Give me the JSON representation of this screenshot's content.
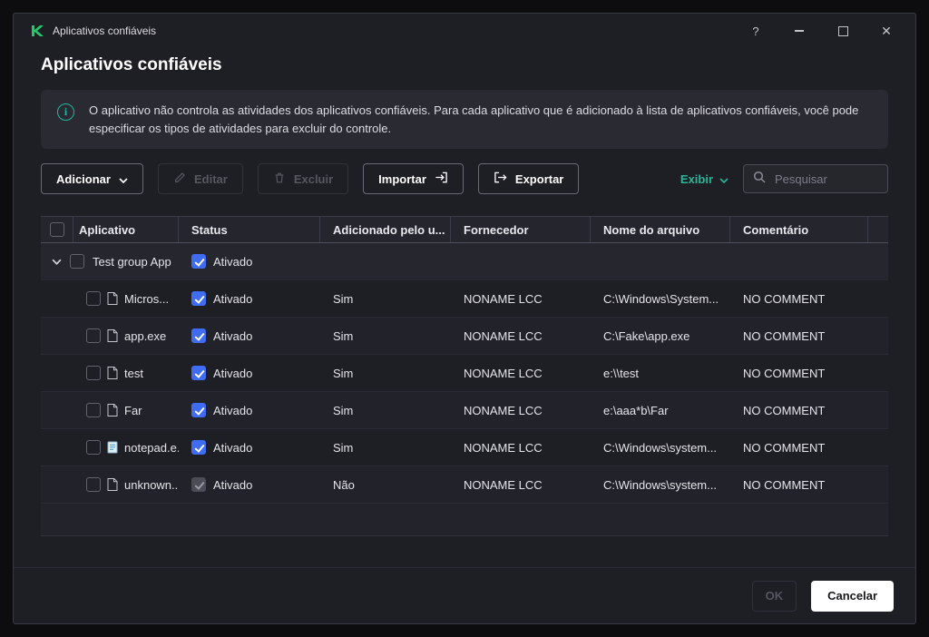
{
  "colors": {
    "accent": "#27b79a",
    "logo_green": "#23c968",
    "checkbox_checked": "#3f6cf0"
  },
  "icons": [
    "kaspersky-logo",
    "help-icon",
    "minimize-icon",
    "maximize-icon",
    "close-icon",
    "info-icon",
    "pencil-icon",
    "trash-icon",
    "import-icon",
    "export-icon",
    "chevron-down-icon",
    "search-icon",
    "file-icon",
    "notepad-icon"
  ],
  "window": {
    "title": "Aplicativos confiáveis",
    "help": "?",
    "close": "✕"
  },
  "page": {
    "title": "Aplicativos confiáveis",
    "info_text": "O aplicativo não controla as atividades dos aplicativos confiáveis. Para cada aplicativo que é adicionado à lista de aplicativos confiáveis, você pode especificar os tipos de atividades para excluir do controle."
  },
  "toolbar": {
    "add_label": "Adicionar",
    "edit_label": "Editar",
    "delete_label": "Excluir",
    "import_label": "Importar",
    "export_label": "Exportar",
    "view_label": "Exibir",
    "search_placeholder": "Pesquisar"
  },
  "table": {
    "columns": [
      "Aplicativo",
      "Status",
      "Adicionado pelo u...",
      "Fornecedor",
      "Nome do arquivo",
      "Comentário"
    ],
    "group_row": {
      "name": "Test group App",
      "status_label": "Ativado",
      "status_enabled": true
    },
    "rows": [
      {
        "name": "Micros...",
        "status_label": "Ativado",
        "status_enabled": true,
        "added_by_user": "Sim",
        "vendor": "NONAME LCC",
        "file_path": "C:\\Windows\\System...",
        "comment": "NO COMMENT"
      },
      {
        "name": "app.exe",
        "status_label": "Ativado",
        "status_enabled": true,
        "added_by_user": "Sim",
        "vendor": "NONAME LCC",
        "file_path": "C:\\Fake\\app.exe",
        "comment": "NO COMMENT"
      },
      {
        "name": "test",
        "status_label": "Ativado",
        "status_enabled": true,
        "added_by_user": "Sim",
        "vendor": "NONAME LCC",
        "file_path": "e:\\\\test",
        "comment": "NO COMMENT"
      },
      {
        "name": "Far",
        "status_label": "Ativado",
        "status_enabled": true,
        "added_by_user": "Sim",
        "vendor": "NONAME LCC",
        "file_path": "e:\\aaa*b\\Far",
        "comment": "NO COMMENT"
      },
      {
        "name": "notepad.e...",
        "status_label": "Ativado",
        "status_enabled": true,
        "added_by_user": "Sim",
        "vendor": "NONAME LCC",
        "file_path": "C:\\Windows\\system...",
        "comment": "NO COMMENT"
      },
      {
        "name": "unknown...",
        "status_label": "Ativado",
        "status_enabled": false,
        "added_by_user": "Não",
        "vendor": "NONAME LCC",
        "file_path": "C:\\Windows\\system...",
        "comment": "NO COMMENT"
      }
    ]
  },
  "footer": {
    "ok_label": "OK",
    "cancel_label": "Cancelar"
  }
}
